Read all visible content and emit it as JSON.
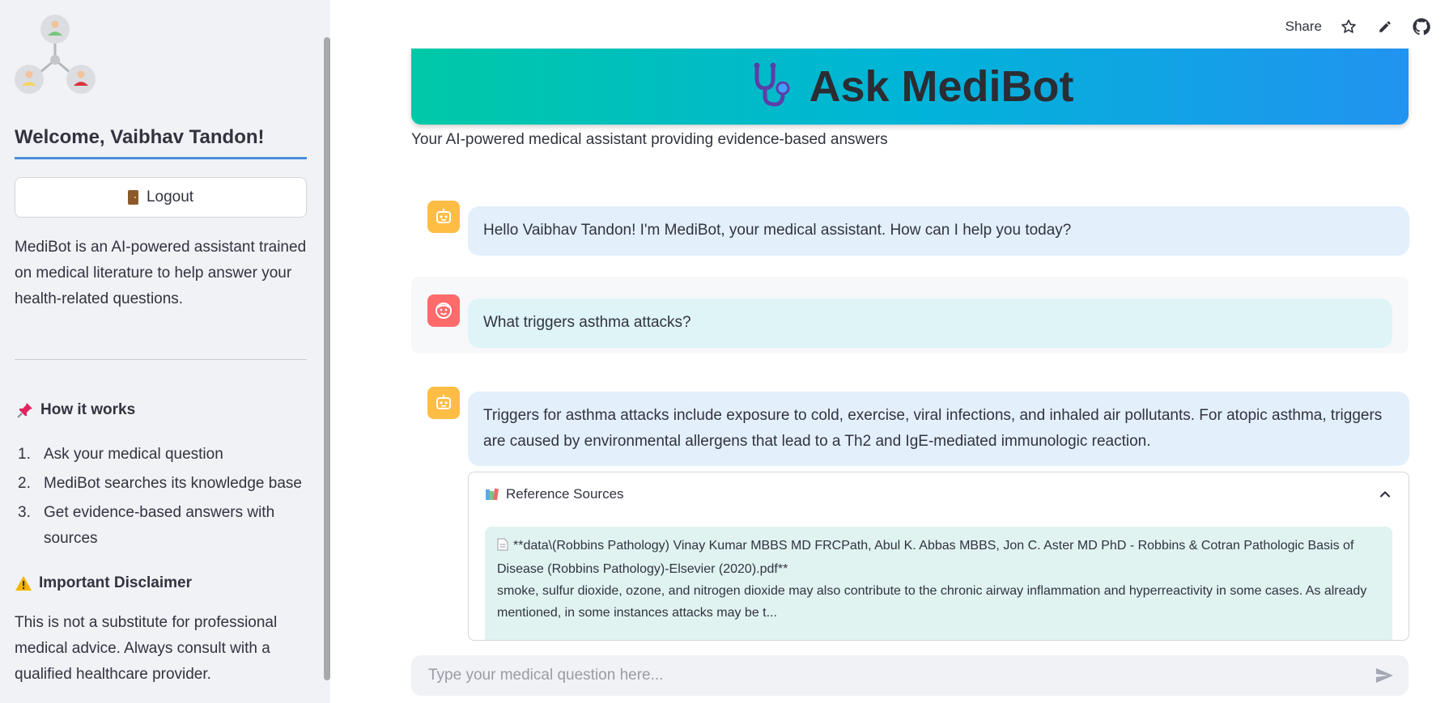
{
  "sidebar": {
    "welcome": "Welcome, Vaibhav Tandon!",
    "logout_label": "Logout",
    "about": "MediBot is an AI-powered assistant trained on medical literature to help answer your health-related questions.",
    "how_it_works": {
      "title": "How it works",
      "icon": "pushpin-icon",
      "steps": [
        {
          "num": "1.",
          "text": "Ask your medical question"
        },
        {
          "num": "2.",
          "text": "MediBot searches its knowledge base"
        },
        {
          "num": "3.",
          "text": "Get evidence-based answers with sources"
        }
      ]
    },
    "disclaimer": {
      "title": "Important Disclaimer",
      "icon": "warning-icon",
      "text": "This is not a substitute for professional medical advice. Always consult with a qualified healthcare provider."
    }
  },
  "toolbar": {
    "share_label": "Share"
  },
  "header": {
    "title": "Ask MediBot",
    "icon": "stethoscope-icon",
    "subtitle": "Your AI-powered medical assistant providing evidence-based answers"
  },
  "chat": {
    "messages": [
      {
        "role": "assistant",
        "text": "Hello Vaibhav Tandon! I'm MediBot, your medical assistant. How can I help you today?"
      },
      {
        "role": "user",
        "text": "What triggers asthma attacks?"
      },
      {
        "role": "assistant",
        "text": "Triggers for asthma attacks include exposure to cold, exercise, viral infections, and inhaled air pollutants. For atopic asthma, triggers are caused by environmental allergens that lead to a Th2 and IgE-mediated immunologic reaction."
      }
    ],
    "references": {
      "title": "Reference Sources",
      "items": [
        {
          "source": "**data\\(Robbins Pathology) Vinay Kumar MBBS MD FRCPath, Abul K. Abbas MBBS, Jon C. Aster MD PhD - Robbins & Cotran Pathologic Basis of Disease (Robbins Pathology)-Elsevier (2020).pdf**",
          "excerpt": "smoke, sulfur dioxide, ozone, and nitrogen dioxide may also contribute to the chronic airway inflammation and hyperreactivity in some cases. As already mentioned, in some instances attacks may be t..."
        }
      ]
    }
  },
  "input": {
    "placeholder": "Type your medical question here..."
  },
  "colors": {
    "accent_line": "#4a90d9",
    "banner_start": "#00c9a7",
    "banner_end": "#2193f0",
    "bot_avatar": "#ffbd45",
    "user_avatar": "#ff6b6b"
  }
}
